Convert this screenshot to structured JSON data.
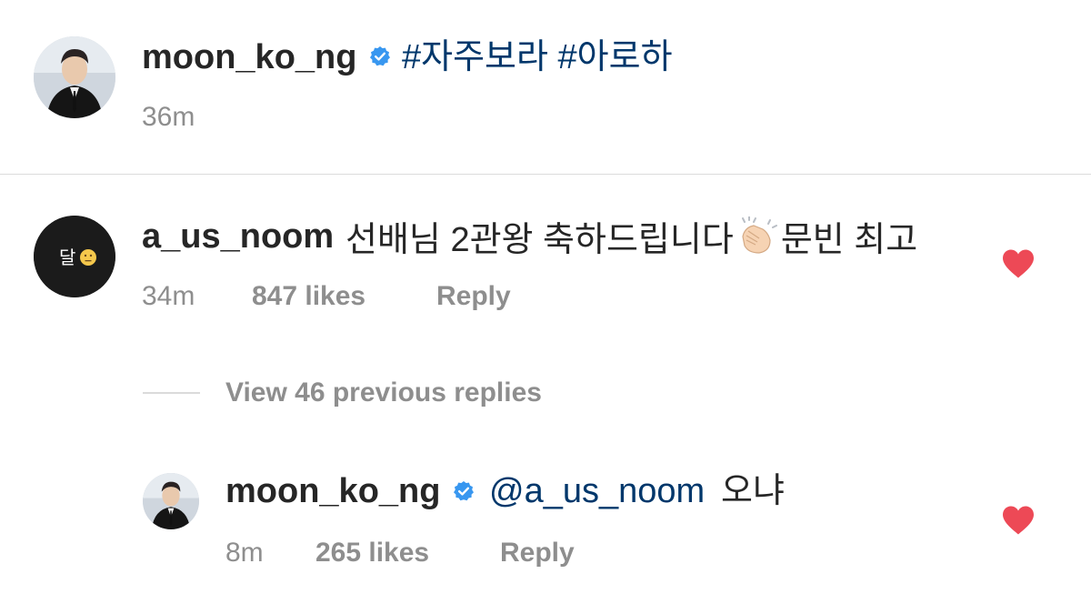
{
  "post": {
    "username": "moon_ko_ng",
    "verified": true,
    "caption": "#자주보라 #아로하",
    "time": "36m",
    "avatar_icon": "profile-photo-man-black-suit"
  },
  "comment": {
    "username": "a_us_noom",
    "text_before_emoji": "선배님 2관왕 축하드립니다",
    "emoji": "clapping-hands-emoji",
    "text_after_emoji": "문빈 최고",
    "time": "34m",
    "likes": "847 likes",
    "reply_label": "Reply",
    "avatar_text": "달",
    "avatar_emoji": "neutral-face-emoji",
    "liked": true
  },
  "view_replies": {
    "label": "View 46 previous replies"
  },
  "reply": {
    "username": "moon_ko_ng",
    "verified": true,
    "mention": "@a_us_noom",
    "text": "오냐",
    "time": "8m",
    "likes": "265 likes",
    "reply_label": "Reply",
    "liked": true
  },
  "colors": {
    "text": "#262626",
    "muted": "#8e8e8e",
    "link": "#00376b",
    "verified": "#3897f0",
    "heart": "#ed4956",
    "divider": "#dbdbdb"
  }
}
